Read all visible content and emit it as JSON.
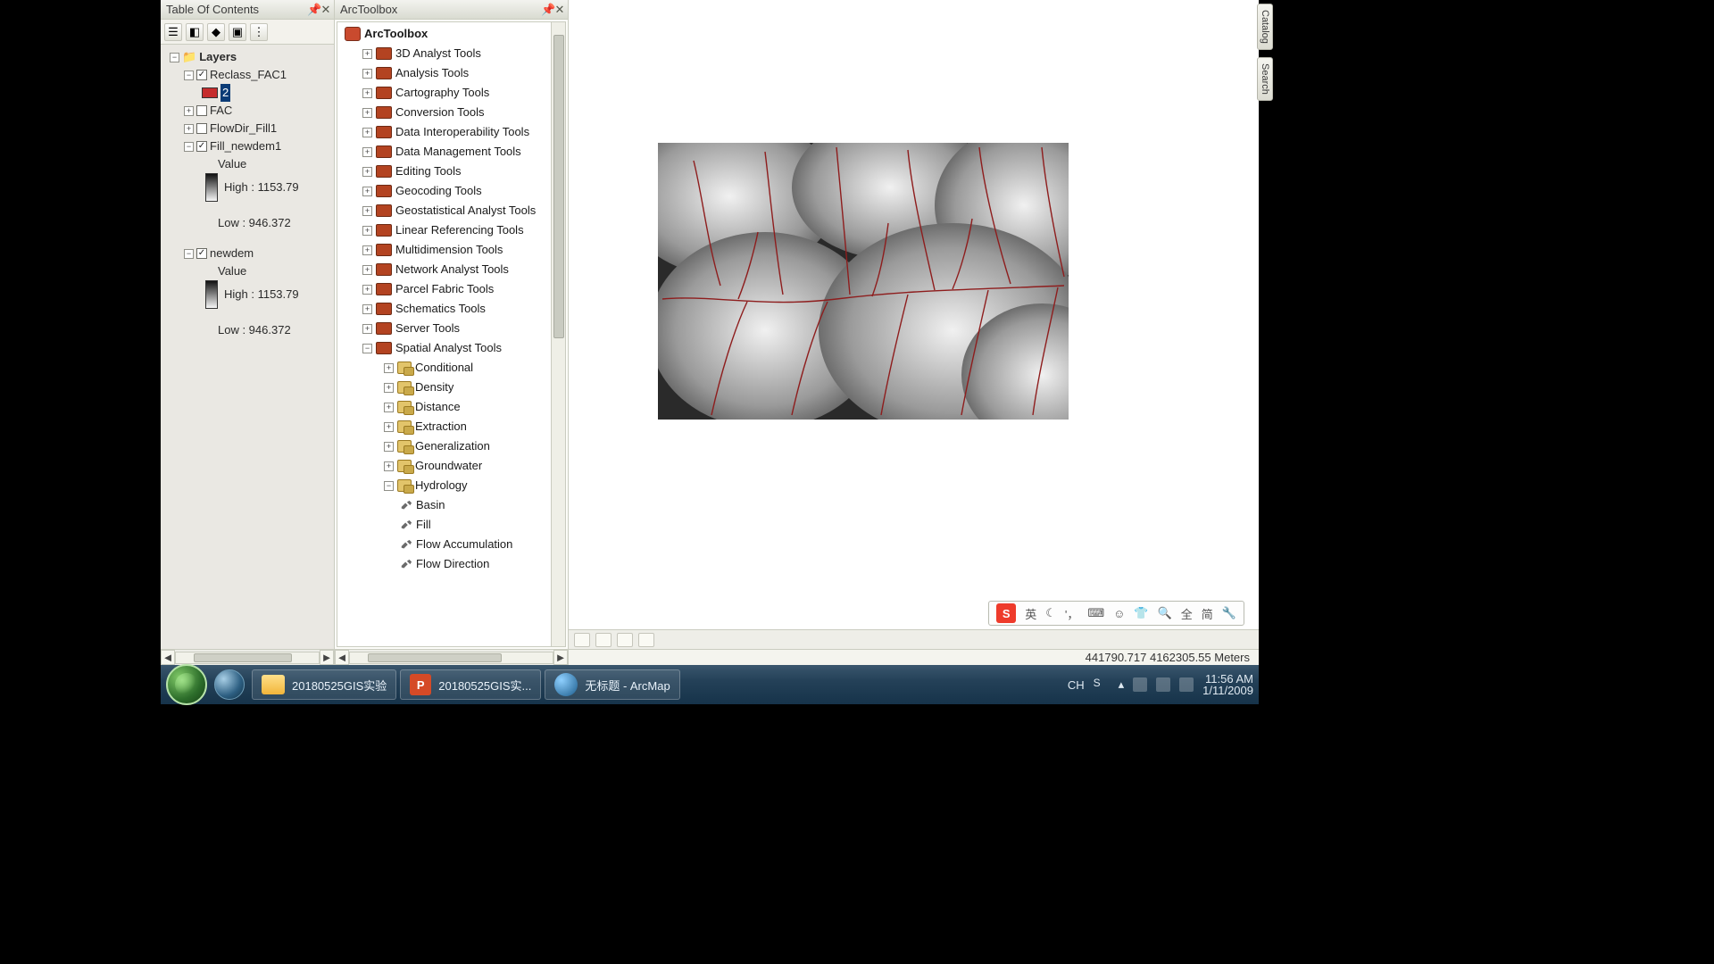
{
  "toc": {
    "title": "Table Of Contents",
    "layers_label": "Layers",
    "reclass": "Reclass_FAC1",
    "reclass_val": "2",
    "fac": "FAC",
    "flowdir": "FlowDir_Fill1",
    "fill": "Fill_newdem1",
    "value_label": "Value",
    "high1": "High : 1153.79",
    "low1": "Low : 946.372",
    "newdem": "newdem",
    "high2": "High : 1153.79",
    "low2": "Low : 946.372"
  },
  "toolbox": {
    "title": "ArcToolbox",
    "root": "ArcToolbox",
    "items": [
      "3D Analyst Tools",
      "Analysis Tools",
      "Cartography Tools",
      "Conversion Tools",
      "Data Interoperability Tools",
      "Data Management Tools",
      "Editing Tools",
      "Geocoding Tools",
      "Geostatistical Analyst Tools",
      "Linear Referencing Tools",
      "Multidimension Tools",
      "Network Analyst Tools",
      "Parcel Fabric Tools",
      "Schematics Tools",
      "Server Tools",
      "Spatial Analyst Tools"
    ],
    "spatial_sub": [
      "Conditional",
      "Density",
      "Distance",
      "Extraction",
      "Generalization",
      "Groundwater",
      "Hydrology"
    ],
    "hydrology_tools": [
      "Basin",
      "Fill",
      "Flow Accumulation",
      "Flow Direction"
    ]
  },
  "side": {
    "catalog": "Catalog",
    "search": "Search"
  },
  "status": {
    "coords": "441790.717  4162305.55 Meters"
  },
  "ime": {
    "lang": "英",
    "full": "全",
    "simp": "简"
  },
  "taskbar": {
    "folder": "20180525GIS实验",
    "ppt": "20180525GIS实...",
    "arcmap": "无标题 - ArcMap",
    "lang": "CH",
    "time": "11:56 AM",
    "date": "1/11/2009"
  }
}
